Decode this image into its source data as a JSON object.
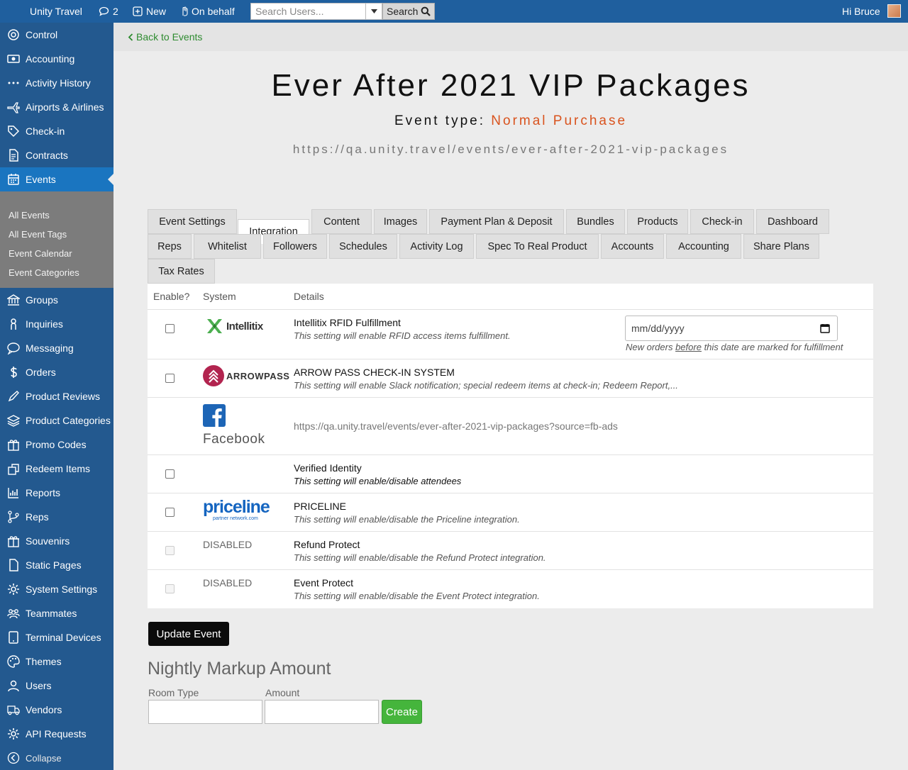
{
  "topbar": {
    "app_title": "Unity Travel",
    "comments_count": "2",
    "new_label": "New",
    "on_behalf_label": "On behalf",
    "search_placeholder": "Search Users...",
    "search_button": "Search",
    "greeting": "Hi Bruce"
  },
  "sidebar": {
    "items": [
      {
        "label": "Control",
        "icon": "dashboard-icon"
      },
      {
        "label": "Accounting",
        "icon": "money-icon"
      },
      {
        "label": "Activity History",
        "icon": "dots-icon"
      },
      {
        "label": "Airports & Airlines",
        "icon": "plane-icon"
      },
      {
        "label": "Check-in",
        "icon": "tag-icon"
      },
      {
        "label": "Contracts",
        "icon": "document-icon"
      },
      {
        "label": "Events",
        "icon": "calendar-icon"
      },
      {
        "label": "Groups",
        "icon": "bank-icon"
      },
      {
        "label": "Inquiries",
        "icon": "person-icon"
      },
      {
        "label": "Messaging",
        "icon": "sms-icon"
      },
      {
        "label": "Orders",
        "icon": "dollar-icon"
      },
      {
        "label": "Product Reviews",
        "icon": "edit-icon"
      },
      {
        "label": "Product Categories",
        "icon": "layers-icon"
      },
      {
        "label": "Promo Codes",
        "icon": "gift-icon"
      },
      {
        "label": "Redeem Items",
        "icon": "redeem-icon"
      },
      {
        "label": "Reports",
        "icon": "chart-icon"
      },
      {
        "label": "Reps",
        "icon": "branch-icon"
      },
      {
        "label": "Souvenirs",
        "icon": "gift-icon"
      },
      {
        "label": "Static Pages",
        "icon": "page-icon"
      },
      {
        "label": "System Settings",
        "icon": "gear-icon"
      },
      {
        "label": "Teammates",
        "icon": "people-icon"
      },
      {
        "label": "Terminal Devices",
        "icon": "tablet-icon"
      },
      {
        "label": "Themes",
        "icon": "palette-icon"
      },
      {
        "label": "Users",
        "icon": "user-icon"
      },
      {
        "label": "Vendors",
        "icon": "truck-icon"
      },
      {
        "label": "API Requests",
        "icon": "gear-icon"
      },
      {
        "label": "Collapse",
        "icon": "collapse-icon"
      }
    ],
    "events_submenu": [
      "All Events",
      "All Event Tags",
      "Event Calendar",
      "Event Categories"
    ]
  },
  "main": {
    "back_link": "Back to Events",
    "title": "Ever After 2021 VIP Packages",
    "event_type_label": "Event type:",
    "event_type_value": "Normal Purchase",
    "event_url": "https://qa.unity.travel/events/ever-after-2021-vip-packages",
    "tabs": [
      "Event Settings",
      "Integration",
      "Content",
      "Images",
      "Payment Plan & Deposit",
      "Bundles",
      "Products",
      "Check-in",
      "Dashboard",
      "Reps",
      "Whitelist",
      "Followers",
      "Schedules",
      "Activity Log",
      "Spec To Real Product",
      "Accounts",
      "Accounting",
      "Share Plans",
      "Tax Rates"
    ],
    "active_tab": "Integration",
    "table": {
      "headers": [
        "Enable?",
        "System",
        "Details"
      ],
      "rows": [
        {
          "system": "Intellitix",
          "title": "Intellitix RFID Fulfillment",
          "desc": "This setting will enable RFID access items fulfillment."
        },
        {
          "system": "ARROWPASS",
          "title": "ARROW PASS CHECK-IN SYSTEM",
          "desc": "This setting will enable Slack notification; special redeem items at check-in; Redeem Report,..."
        },
        {
          "system": "Facebook",
          "url": "https://qa.unity.travel/events/ever-after-2021-vip-packages?source=fb-ads"
        },
        {
          "system": "",
          "title": "Verified Identity",
          "desc": "This setting will enable/disable attendees"
        },
        {
          "system": "priceline",
          "system_sub": "partner network.com",
          "title": "PRICELINE",
          "desc": "This setting will enable/disable the Priceline integration."
        },
        {
          "system": "DISABLED",
          "title": "Refund Protect",
          "desc": "This setting will enable/disable the Refund Protect integration."
        },
        {
          "system": "DISABLED",
          "title": "Event Protect",
          "desc": "This setting will enable/disable the Event Protect integration."
        }
      ],
      "date_placeholder": "mm/dd/yyyy",
      "date_note_pre": "New orders ",
      "date_note_link": "before",
      "date_note_post": " this date are marked for fulfillment"
    },
    "update_button": "Update Event",
    "markup": {
      "title": "Nightly Markup Amount",
      "room_type_label": "Room Type",
      "amount_label": "Amount",
      "create_button": "Create"
    }
  },
  "colors": {
    "topbar": "#1f5f9e",
    "sidebar": "#23598f",
    "active_nav": "#1a75c0",
    "event_type": "#d9531e",
    "back_link": "#2e8b30",
    "create": "#45b53c"
  }
}
